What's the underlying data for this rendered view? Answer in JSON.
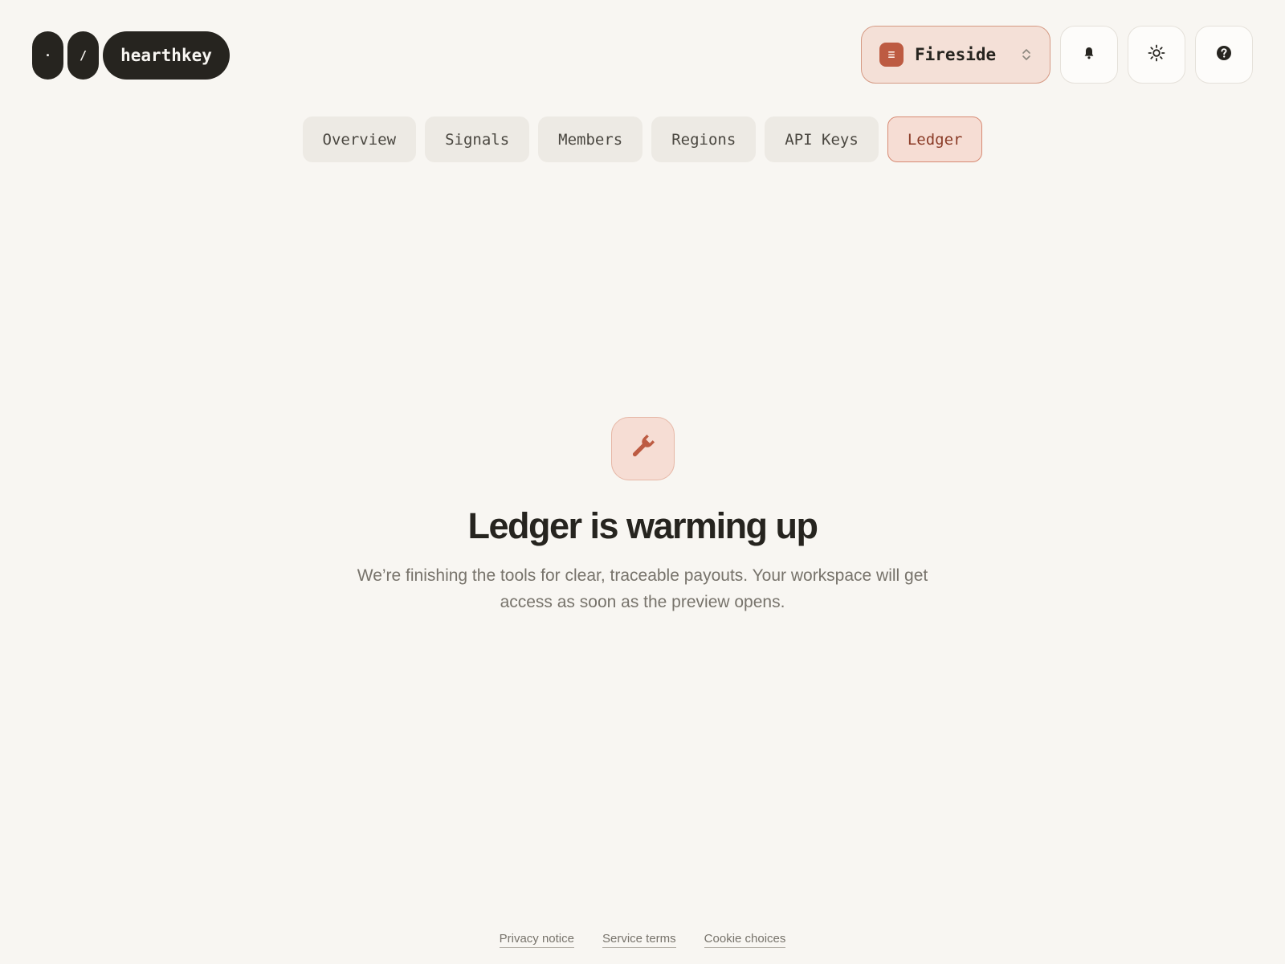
{
  "brand": {
    "mark_dot": "·",
    "mark_slash": "/",
    "wordmark": "hearthkey"
  },
  "workspace": {
    "name": "Fireside",
    "icon": "document-lines-icon",
    "switch_icon": "chevron-up-down-icon"
  },
  "header_buttons": {
    "notifications_icon": "bell-icon",
    "theme_icon": "sun-icon",
    "help_icon": "help-circle-icon"
  },
  "tabs": [
    {
      "label": "Overview",
      "active": false
    },
    {
      "label": "Signals",
      "active": false
    },
    {
      "label": "Members",
      "active": false
    },
    {
      "label": "Regions",
      "active": false
    },
    {
      "label": "API Keys",
      "active": false
    },
    {
      "label": "Ledger",
      "active": true
    }
  ],
  "empty_state": {
    "icon": "wrench-icon",
    "title": "Ledger is warming up",
    "description": "We’re finishing the tools for clear, traceable payouts. Your workspace will get access as soon as the preview opens."
  },
  "footer": {
    "privacy": "Privacy notice",
    "terms": "Service terms",
    "cookies": "Cookie choices"
  },
  "colors": {
    "background": "#f8f6f2",
    "ink": "#26241f",
    "accent": "#bd5b42",
    "accent_soft": "#f6ddd4",
    "muted_text": "#77736b"
  }
}
